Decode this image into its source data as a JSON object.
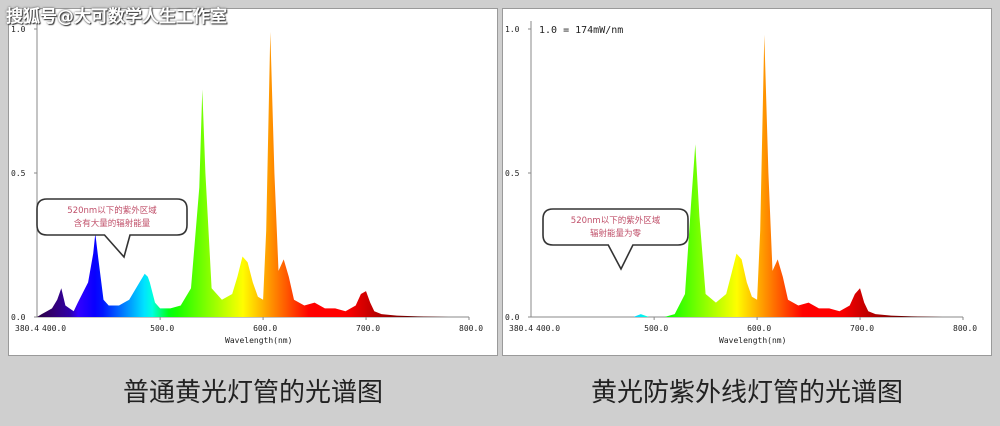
{
  "watermark": "搜狐号@大可数学人生工作室",
  "captions": [
    "普通黄光灯管的光谱图",
    "黄光防紫外线灯管的光谱图"
  ],
  "panels": [
    {
      "id": "normal",
      "scale_note": "",
      "bubble": [
        "520nm以下的紫外区域",
        "含有大量的辐射能量"
      ]
    },
    {
      "id": "uv-blocking",
      "scale_note": "1.0 = 174mW/nm",
      "bubble": [
        "520nm以下的紫外区域",
        "辐射能量为零"
      ]
    }
  ],
  "chart_data": [
    {
      "type": "area",
      "title": "",
      "xlabel": "Wavelength(nm)",
      "ylabel": "",
      "xlim": [
        380.4,
        800.0
      ],
      "ylim": [
        0,
        1.0
      ],
      "x_ticks": [
        "380.4",
        "400.0",
        "500.0",
        "600.0",
        "700.0",
        "800.0"
      ],
      "y_ticks": [
        "0.0",
        "0.5",
        "1.0"
      ],
      "series": [
        {
          "x": [
            380.4,
            385,
            390,
            395,
            400,
            404,
            408,
            412,
            416,
            420,
            430,
            435,
            437,
            440,
            445,
            450,
            460,
            470,
            480,
            485,
            488,
            490,
            495,
            500,
            510,
            520,
            530,
            538,
            541,
            544,
            550,
            560,
            570,
            575,
            580,
            585,
            590,
            595,
            600,
            603,
            607,
            611,
            615,
            620,
            625,
            630,
            640,
            650,
            660,
            670,
            680,
            690,
            695,
            700,
            704,
            708,
            715,
            730,
            750,
            780,
            800
          ],
          "y": [
            0.0,
            0.01,
            0.02,
            0.03,
            0.06,
            0.1,
            0.04,
            0.03,
            0.02,
            0.05,
            0.12,
            0.22,
            0.29,
            0.2,
            0.06,
            0.04,
            0.04,
            0.06,
            0.12,
            0.15,
            0.14,
            0.12,
            0.05,
            0.03,
            0.03,
            0.04,
            0.1,
            0.45,
            0.79,
            0.5,
            0.1,
            0.06,
            0.08,
            0.14,
            0.21,
            0.19,
            0.12,
            0.07,
            0.06,
            0.3,
            0.99,
            0.5,
            0.16,
            0.2,
            0.14,
            0.06,
            0.04,
            0.05,
            0.03,
            0.03,
            0.02,
            0.04,
            0.08,
            0.09,
            0.05,
            0.02,
            0.01,
            0.005,
            0.002,
            0.0,
            0.0
          ]
        }
      ]
    },
    {
      "type": "area",
      "title": "",
      "xlabel": "Wavelength(nm)",
      "ylabel": "",
      "xlim": [
        380.4,
        800.0
      ],
      "ylim": [
        0,
        1.0
      ],
      "x_ticks": [
        "380.4",
        "400.0",
        "500.0",
        "600.0",
        "700.0",
        "800.0"
      ],
      "y_ticks": [
        "0.0",
        "0.5",
        "1.0"
      ],
      "series": [
        {
          "x": [
            380.4,
            400,
            450,
            480,
            487,
            495,
            510,
            520,
            530,
            536,
            540,
            544,
            550,
            560,
            570,
            575,
            580,
            585,
            590,
            595,
            600,
            603,
            607,
            611,
            615,
            620,
            625,
            630,
            640,
            650,
            660,
            670,
            680,
            690,
            695,
            700,
            704,
            708,
            715,
            730,
            750,
            780,
            800
          ],
          "y": [
            0.0,
            0.0,
            0.0,
            0.0,
            0.01,
            0.0,
            0.0,
            0.01,
            0.08,
            0.4,
            0.6,
            0.35,
            0.08,
            0.05,
            0.08,
            0.15,
            0.22,
            0.2,
            0.12,
            0.07,
            0.06,
            0.3,
            0.98,
            0.5,
            0.16,
            0.2,
            0.14,
            0.06,
            0.04,
            0.05,
            0.03,
            0.03,
            0.02,
            0.04,
            0.08,
            0.1,
            0.05,
            0.02,
            0.01,
            0.005,
            0.002,
            0.0,
            0.0
          ]
        }
      ]
    }
  ]
}
